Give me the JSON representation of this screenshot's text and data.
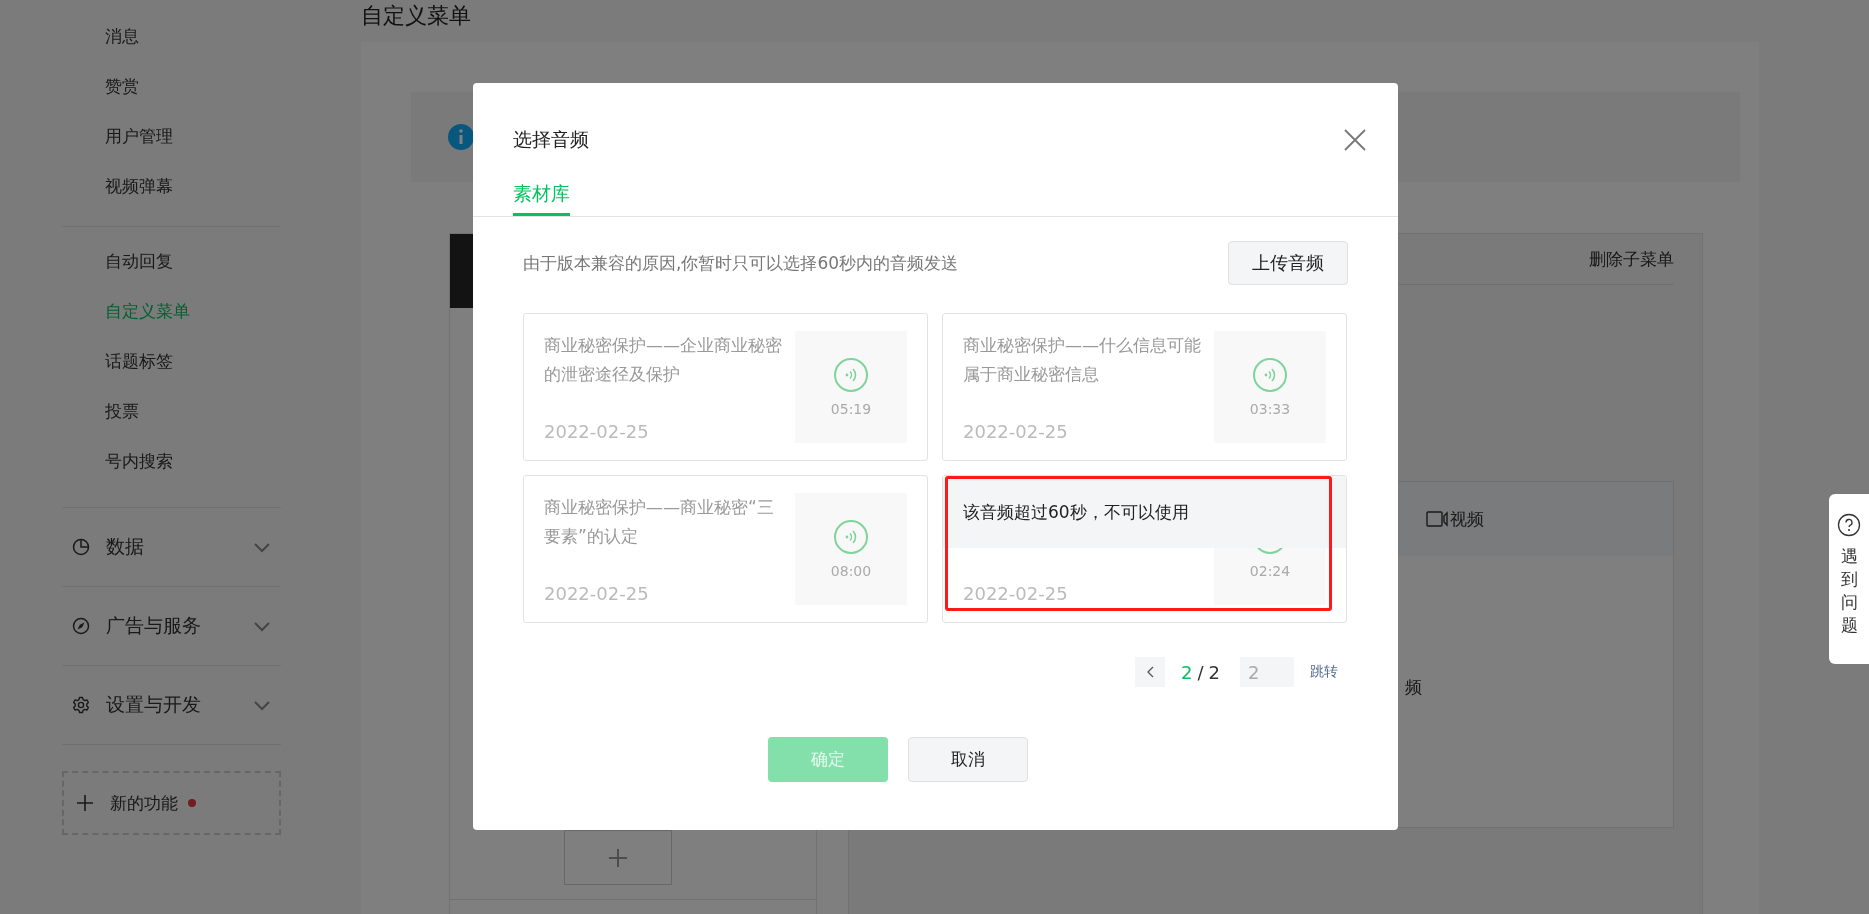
{
  "page_title": "自定义菜单",
  "sidebar": {
    "groups": [
      [
        {
          "label": "消息",
          "selected": false
        },
        {
          "label": "赞赏",
          "selected": false
        },
        {
          "label": "用户管理",
          "selected": false
        },
        {
          "label": "视频弹幕",
          "selected": false
        }
      ],
      [
        {
          "label": "自动回复",
          "selected": false
        },
        {
          "label": "自定义菜单",
          "selected": true
        },
        {
          "label": "话题标签",
          "selected": false
        },
        {
          "label": "投票",
          "selected": false
        },
        {
          "label": "号内搜索",
          "selected": false
        }
      ]
    ],
    "sections": [
      {
        "label": "数据",
        "expanded": false
      },
      {
        "label": "广告与服务",
        "expanded": false
      },
      {
        "label": "设置与开发",
        "expanded": false
      }
    ],
    "new_feature": {
      "label": "新的功能",
      "dot": true
    }
  },
  "editor": {
    "delete_submenu": "删除子菜单",
    "media_tab": "视频",
    "partial_text": "频"
  },
  "modal": {
    "title": "选择音频",
    "tabs": [
      {
        "label": "素材库",
        "selected": true
      }
    ],
    "notice": "由于版本兼容的原因,你暂时只可以选择60秒内的音频发送",
    "upload_button": "上传音频",
    "audio_items": [
      {
        "title": "商业秘密保护——企业商业秘密的泄密途径及保护",
        "date": "2022-02-25",
        "duration": "05:19",
        "disabled": false,
        "highlighted": false
      },
      {
        "title": "商业秘密保护——什么信息可能属于商业秘密信息",
        "date": "2022-02-25",
        "duration": "03:33",
        "disabled": false,
        "highlighted": false
      },
      {
        "title": "商业秘密保护——商业秘密“三要素”的认定",
        "date": "2022-02-25",
        "duration": "08:00",
        "disabled": false,
        "highlighted": false
      },
      {
        "disabled_message": "该音频超过60秒，不可以使用",
        "date": "2022-02-25",
        "duration": "02:24",
        "disabled": true,
        "highlighted": true
      }
    ],
    "pagination": {
      "current": "2",
      "separator": "/",
      "total": "2",
      "page_input": "2",
      "jump": "跳转"
    },
    "confirm_button": {
      "label": "确定",
      "disabled": true
    },
    "cancel_button": "取消"
  },
  "help_widget": {
    "label": "遇到问题"
  }
}
